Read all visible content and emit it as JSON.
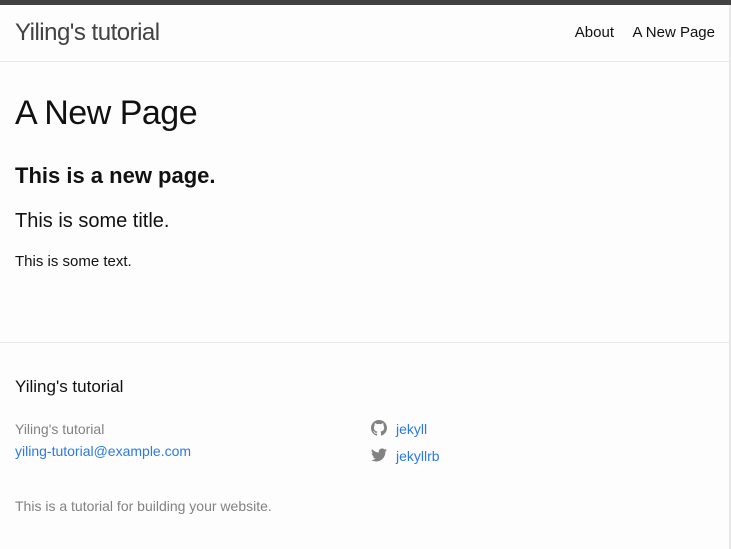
{
  "header": {
    "site_title": "Yiling's tutorial",
    "nav": [
      {
        "label": "About"
      },
      {
        "label": "A New Page"
      }
    ]
  },
  "main": {
    "title": "A New Page",
    "heading": "This is a new page.",
    "subtitle": "This is some title.",
    "text": "This is some text."
  },
  "footer": {
    "heading": "Yiling's tutorial",
    "name": "Yiling's tutorial",
    "email": "yiling-tutorial@example.com",
    "social": [
      {
        "icon": "github-icon",
        "label": "jekyll"
      },
      {
        "icon": "twitter-icon",
        "label": "jekyllrb"
      }
    ],
    "description": "This is a tutorial for building your website."
  },
  "colors": {
    "header_bar": "#424242",
    "link": "#2a7ae2",
    "muted_text": "#828282",
    "background": "#fdfdfd"
  }
}
